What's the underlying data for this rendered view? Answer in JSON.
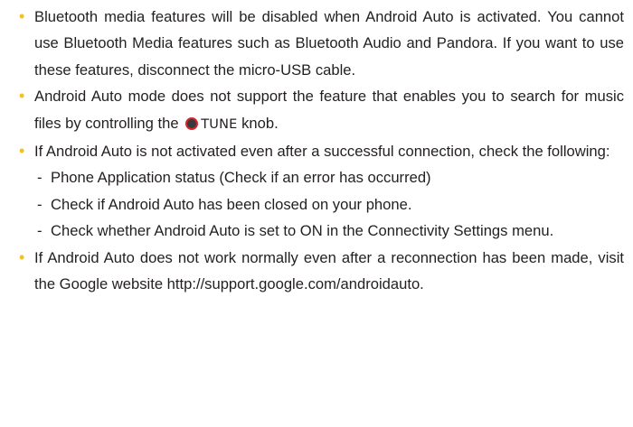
{
  "bullet_color": "#f2c318",
  "knob_colors": {
    "fill": "#3a3a3a",
    "ring": "#d6262e"
  },
  "bullets": [
    {
      "text": "Bluetooth media features will be disabled when Android Auto is activated. You cannot use Bluetooth Media features such as Bluetooth Audio and Pandora. If you want to use these features, disconnect the micro-USB cable."
    },
    {
      "text_before": "Android Auto mode does not support the feature that enables you to search for music files by controlling the",
      "knob_icon": "knob-icon",
      "knob_label": "TUNE",
      "text_after": "knob."
    },
    {
      "text": "If Android Auto is not activated even after a successful connection, check the following:",
      "sub_items": [
        "Phone Application status (Check if an error has occurred)",
        "Check if Android Auto has been closed on your phone.",
        "Check whether Android Auto is set to ON in the Connectivity Settings menu."
      ]
    },
    {
      "text": "If Android Auto does not work normally even after a reconnection has been made, visit the Google website http://support.google.com/androidauto."
    }
  ],
  "sub_item_marker": "-",
  "bullet_marker": "•"
}
